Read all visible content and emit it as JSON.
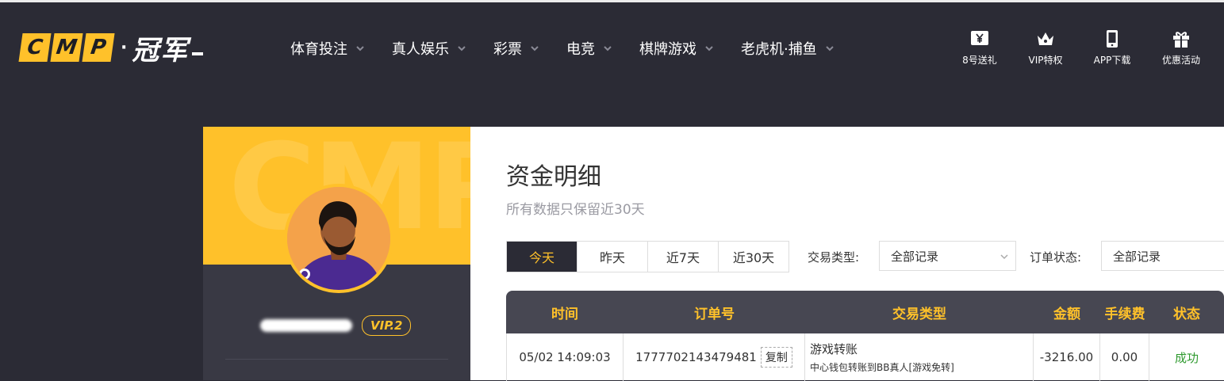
{
  "logo": {
    "letters": [
      "C",
      "M",
      "P"
    ],
    "dot": "·",
    "cn": "冠军"
  },
  "nav": [
    {
      "label": "体育投注"
    },
    {
      "label": "真人娱乐"
    },
    {
      "label": "彩票"
    },
    {
      "label": "电竞"
    },
    {
      "label": "棋牌游戏"
    },
    {
      "label": "老虎机·捕鱼"
    }
  ],
  "quick_links": [
    {
      "label": "8号送礼",
      "icon": "yen-ticket-icon"
    },
    {
      "label": "VIP特权",
      "icon": "crown-icon"
    },
    {
      "label": "APP下载",
      "icon": "phone-icon"
    },
    {
      "label": "优惠活动",
      "icon": "gift-icon"
    }
  ],
  "profile": {
    "banner_text": "CMP",
    "vip": "VIP.2"
  },
  "page": {
    "title": "资金明细",
    "subtitle": "所有数据只保留近30天"
  },
  "date_tabs": [
    {
      "label": "今天",
      "active": true
    },
    {
      "label": "昨天",
      "active": false
    },
    {
      "label": "近7天",
      "active": false
    },
    {
      "label": "近30天",
      "active": false
    }
  ],
  "filters": {
    "type_label": "交易类型:",
    "type_value": "全部记录",
    "status_label": "订单状态:",
    "status_value": "全部记录"
  },
  "table": {
    "columns": [
      "时间",
      "订单号",
      "交易类型",
      "金额",
      "手续费",
      "状态"
    ],
    "rows": [
      {
        "time": "05/02 14:09:03",
        "order": "1777702143479481",
        "copy": "复制",
        "type": "游戏转账",
        "type_detail": "中心钱包转账到BB真人[游戏免转]",
        "amount": "-3216.00",
        "fee": "0.00",
        "status": "成功"
      }
    ]
  },
  "colors": {
    "accent": "#ffc12a",
    "header_bg": "#2b2b35",
    "success": "#2f9a2f"
  }
}
